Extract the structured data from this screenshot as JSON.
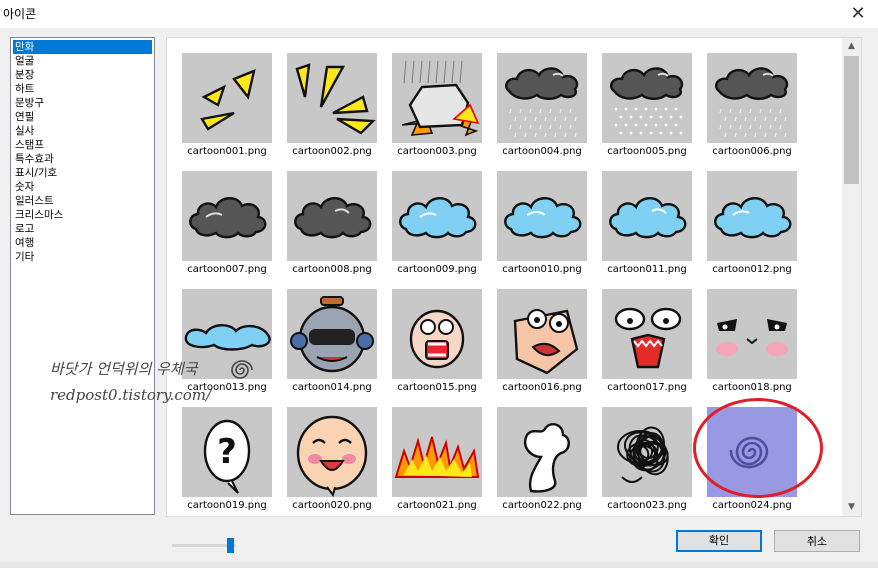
{
  "window": {
    "title": "아이콘",
    "close_symbol": "✕"
  },
  "categories": [
    "만화",
    "얼굴",
    "분장",
    "하트",
    "문방구",
    "연필",
    "실사",
    "스탬프",
    "특수효과",
    "표시/기호",
    "숫자",
    "일러스트",
    "크리스마스",
    "로고",
    "여행",
    "기타"
  ],
  "selected_category": "만화",
  "icons": [
    {
      "name": "cartoon001.png",
      "art": "yellow-spikes-3"
    },
    {
      "name": "cartoon002.png",
      "art": "yellow-spikes-4"
    },
    {
      "name": "cartoon003.png",
      "art": "rock-crash"
    },
    {
      "name": "cartoon004.png",
      "art": "rain-cloud"
    },
    {
      "name": "cartoon005.png",
      "art": "snow-cloud"
    },
    {
      "name": "cartoon006.png",
      "art": "rain-cloud-2"
    },
    {
      "name": "cartoon007.png",
      "art": "dark-cloud"
    },
    {
      "name": "cartoon008.png",
      "art": "dark-cloud-2"
    },
    {
      "name": "cartoon009.png",
      "art": "blue-cloud"
    },
    {
      "name": "cartoon010.png",
      "art": "blue-cloud-2"
    },
    {
      "name": "cartoon011.png",
      "art": "blue-cloud-3"
    },
    {
      "name": "cartoon012.png",
      "art": "blue-cloud-4"
    },
    {
      "name": "cartoon013.png",
      "art": "blue-cloud-flat"
    },
    {
      "name": "cartoon014.png",
      "art": "robot-head"
    },
    {
      "name": "cartoon015.png",
      "art": "scared-face"
    },
    {
      "name": "cartoon016.png",
      "art": "shocked-head"
    },
    {
      "name": "cartoon017.png",
      "art": "screaming-face"
    },
    {
      "name": "cartoon018.png",
      "art": "blush-eyes"
    },
    {
      "name": "cartoon019.png",
      "art": "question-bubble"
    },
    {
      "name": "cartoon020.png",
      "art": "happy-face"
    },
    {
      "name": "cartoon021.png",
      "art": "fire"
    },
    {
      "name": "cartoon022.png",
      "art": "puff"
    },
    {
      "name": "cartoon023.png",
      "art": "scribble"
    },
    {
      "name": "cartoon024.png",
      "art": "spiral"
    }
  ],
  "selected_icon": "cartoon024.png",
  "slider_value": 0.92,
  "buttons": {
    "ok": "확인",
    "cancel": "취소"
  },
  "watermark": {
    "line1": "바닷가 언덕위의 우체국",
    "line2": "redpost0.tistory.com/"
  },
  "colors": {
    "accent": "#0078d7",
    "highlight_circle": "#e01e28",
    "thumb_bg": "#c8c8c8",
    "selected_thumb_bg": "#9999e3"
  }
}
